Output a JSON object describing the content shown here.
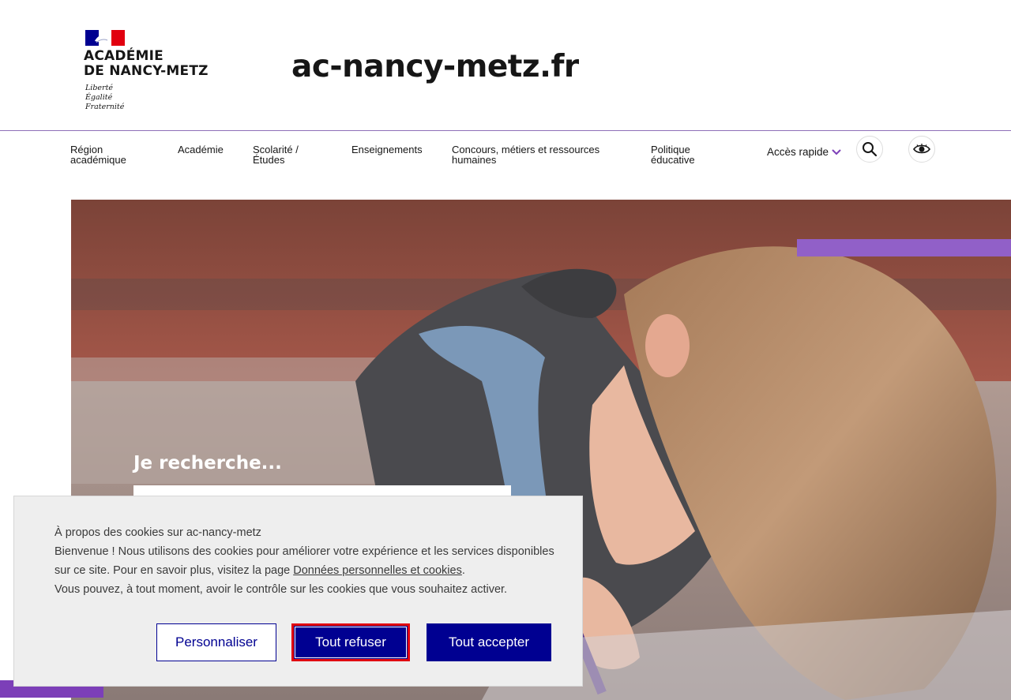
{
  "brand": {
    "name_line1": "ACADÉMIE",
    "name_line2": "DE NANCY-METZ",
    "motto": [
      "Liberté",
      "Égalité",
      "Fraternité"
    ]
  },
  "site_title": "ac-nancy-metz.fr",
  "nav": {
    "items": [
      {
        "line1": "Région",
        "line2": "académique"
      },
      {
        "line1": "Académie",
        "line2": ""
      },
      {
        "line1": "Scolarité /",
        "line2": "Études"
      },
      {
        "line1": "Enseignements",
        "line2": ""
      },
      {
        "line1": "Concours, métiers et ressources",
        "line2": "humaines"
      },
      {
        "line1": "Politique",
        "line2": "éducative"
      }
    ],
    "quick_access_label": "Accès rapide",
    "search_icon": "search-icon",
    "accessibility_icon": "eye-icon"
  },
  "hero": {
    "search_label": "Je recherche...",
    "search_value": ""
  },
  "cookie": {
    "title": "À propos des cookies sur ac-nancy-metz",
    "text_before_link": "Bienvenue ! Nous utilisons des cookies pour améliorer votre expérience et les services disponibles sur ce site. Pour en savoir plus, visitez la page ",
    "link_label": "Données personnelles et cookies",
    "text_after_link": ".",
    "text_line_last": "Vous pouvez, à tout moment, avoir le contrôle sur les cookies que vous souhaitez activer.",
    "btn_customize": "Personnaliser",
    "btn_refuse": "Tout refuser",
    "btn_accept": "Tout accepter"
  },
  "colors": {
    "accent_purple": "#9160c8",
    "primary_blue": "#000091",
    "focus_red": "#e1000f"
  }
}
